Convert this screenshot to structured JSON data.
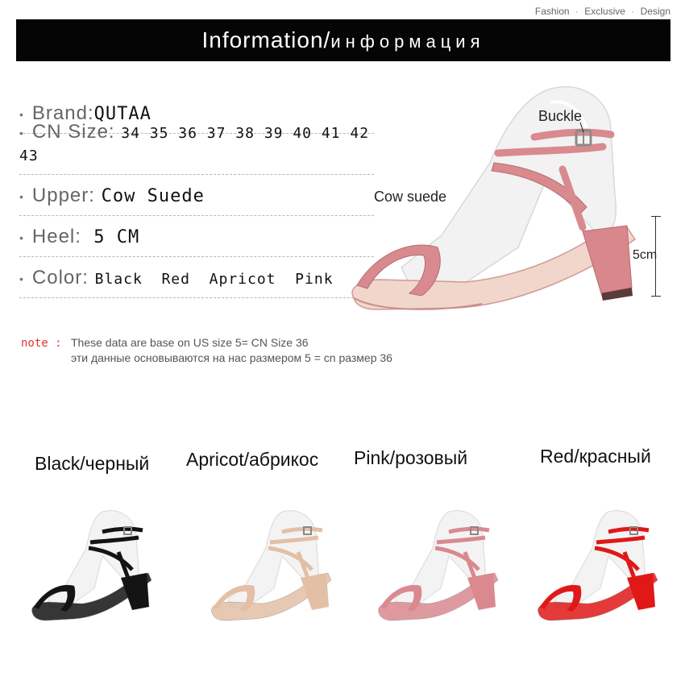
{
  "tagline": {
    "a": "Fashion",
    "b": "Exclusive",
    "c": "Design",
    "sep": "·"
  },
  "banner": {
    "en": "Information/",
    "ru": "информация"
  },
  "specs": [
    {
      "label": "Brand:",
      "value": "QUTAA"
    },
    {
      "label": "CN Size:",
      "value": "34 35 36 37 38 39 40 41 42 43"
    },
    {
      "label": "Upper:",
      "value": "Cow Suede"
    },
    {
      "label": "Heel:",
      "value": "5 CM"
    },
    {
      "label": "Color:",
      "value": "Black  Red  Apricot  Pink"
    }
  ],
  "bullet": "•",
  "annotations": {
    "buckle": "Buckle",
    "cow_suede": "Cow suede",
    "heel_dim": "5cm"
  },
  "note": {
    "label": "note :",
    "line1": "These data are base on US size 5= CN Size 36",
    "line2": "эти данные основываются на нас размером 5 = cn размер 36"
  },
  "colors": [
    {
      "label": "Black/черный",
      "hex": "#141414"
    },
    {
      "label": "Apricot/абрикос",
      "hex": "#e3bfa6"
    },
    {
      "label": "Pink/розовый",
      "hex": "#d9898f"
    },
    {
      "label": "Red/красный",
      "hex": "#e01818"
    }
  ],
  "main_color": "#d88a8e"
}
